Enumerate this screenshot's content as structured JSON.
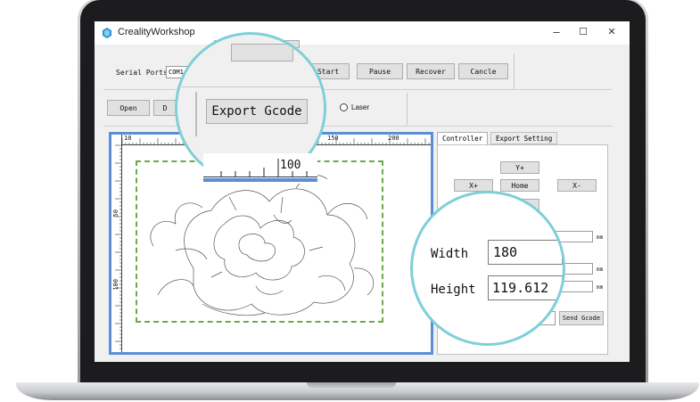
{
  "window": {
    "title": "CrealityWorkshop",
    "minimize": "–",
    "maximize": "☐",
    "close": "✕"
  },
  "toolbar": {
    "serial_ports_label": "Serial Ports",
    "serial_port_value": "COM1",
    "start_label": "Start",
    "pause_label": "Pause",
    "recover_label": "Recover",
    "cancel_label": "Cancle",
    "open_label": "Open",
    "d_label": "D",
    "export_gcode_label": "Export Gcode",
    "laser_label": "Laser"
  },
  "ruler": {
    "top_ticks": [
      "10",
      "150",
      "200"
    ],
    "left_ticks": [
      "50",
      "100"
    ],
    "zoom_tick": "100"
  },
  "tabs": {
    "controller": "Controller",
    "export_setting": "Export Setting"
  },
  "controller": {
    "y_plus": "Y+",
    "x_plus": "X+",
    "home": "Home",
    "x_minus": "X-",
    "y_minus": "Y-"
  },
  "size": {
    "width_label": "Width",
    "width_value": "180",
    "height_label": "Height",
    "height_value": "119.612",
    "unit": "mm"
  },
  "send_gcode_label": "Send Gcode",
  "colors": {
    "accent_blue": "#5b8ed6",
    "work_area_green": "#6aaa4a",
    "magnifier_ring": "#7ecfd8"
  }
}
